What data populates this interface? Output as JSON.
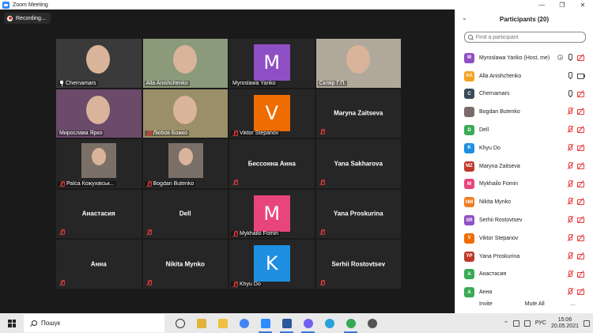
{
  "window": {
    "title": "Zoom Meeting",
    "minimize": "—",
    "maximize": "❐",
    "close": "✕"
  },
  "recording": {
    "label": "Recording..."
  },
  "tiles": [
    {
      "name": "Chernamars",
      "type": "video",
      "pin": true,
      "muted": false,
      "bg": "#3a3a3a"
    },
    {
      "name": "Alla Anishchenko",
      "type": "video",
      "active": true,
      "muted": false,
      "bg": "#8a9a7a"
    },
    {
      "name": "Myroslawa Yariko",
      "type": "letter",
      "letter": "M",
      "color": "#8f4fc4",
      "muted": false
    },
    {
      "name": "Скляр Г.П.",
      "type": "video",
      "muted": false,
      "bg": "#b0a89a"
    },
    {
      "name": "Мирослава Ярко",
      "type": "video",
      "muted": false,
      "bg": "#6b4a6a"
    },
    {
      "name": "Любов Божко",
      "type": "video",
      "muted": true,
      "bg": "#9b8f6a"
    },
    {
      "name": "Viktor Stepanov",
      "type": "letter",
      "letter": "V",
      "color": "#ef6c00",
      "muted": true
    },
    {
      "name": "Maryna Zaitseva",
      "type": "name",
      "muted": true
    },
    {
      "name": "Раїса Кожухівськ...",
      "type": "video",
      "muted": true,
      "bg": "#262626"
    },
    {
      "name": "Bogdan Butenko",
      "type": "video",
      "muted": true,
      "bg": "#262626"
    },
    {
      "name": "Бессонна Анна",
      "type": "name",
      "muted": true
    },
    {
      "name": "Yana Sakharova",
      "type": "name",
      "muted": true
    },
    {
      "name": "Анастасия",
      "type": "name",
      "muted": true
    },
    {
      "name": "Dell",
      "type": "name",
      "muted": true
    },
    {
      "name": "Mykhailo Fomin",
      "type": "letter",
      "letter": "M",
      "color": "#e8457c",
      "muted": true
    },
    {
      "name": "Yana Proskurina",
      "type": "name",
      "muted": true
    },
    {
      "name": "Анна",
      "type": "name",
      "muted": true
    },
    {
      "name": "Nikita Mynko",
      "type": "name",
      "muted": true
    },
    {
      "name": "Khyu Do",
      "type": "letter",
      "letter": "K",
      "color": "#1e8fe1",
      "muted": true
    },
    {
      "name": "Serhii Rostovtsev",
      "type": "name",
      "muted": true
    }
  ],
  "panel": {
    "title": "Participants (20)",
    "collapse_icon": "⌄",
    "search_placeholder": "Find a participant",
    "participants": [
      {
        "initials": "M",
        "name": "Myroslawa Yariko (Host, me)",
        "color": "#8f4fc4",
        "state": "host"
      },
      {
        "initials": "AA",
        "name": "Alla Anishchenko",
        "color": "#f4a11d",
        "state": "live"
      },
      {
        "initials": "C",
        "name": "Chernamars",
        "color": "#3b4a5a",
        "state": "mic-on-cam-muted"
      },
      {
        "initials": "",
        "name": "Bogdan Butenko",
        "color": "#7a6a6a",
        "state": "muted"
      },
      {
        "initials": "D",
        "name": "Dell",
        "color": "#3aaa55",
        "state": "muted"
      },
      {
        "initials": "K",
        "name": "Khyu Do",
        "color": "#1e8fe1",
        "state": "muted"
      },
      {
        "initials": "MZ",
        "name": "Maryna Zaitseva",
        "color": "#c0392b",
        "state": "muted"
      },
      {
        "initials": "M",
        "name": "Mykhailo Fomin",
        "color": "#e8457c",
        "state": "muted"
      },
      {
        "initials": "NM",
        "name": "Nikita Mynko",
        "color": "#f07d23",
        "state": "muted"
      },
      {
        "initials": "SR",
        "name": "Serhii Rostovtsev",
        "color": "#8f4fc4",
        "state": "muted"
      },
      {
        "initials": "V",
        "name": "Viktor Stepanov",
        "color": "#ef6c00",
        "state": "muted"
      },
      {
        "initials": "YP",
        "name": "Yana Proskurina",
        "color": "#c0392b",
        "state": "muted"
      },
      {
        "initials": "A",
        "name": "Анастасия",
        "color": "#3aaa55",
        "state": "muted"
      },
      {
        "initials": "A",
        "name": "Анна",
        "color": "#3aaa55",
        "state": "muted"
      }
    ],
    "invite_label": "Invite",
    "mute_all_label": "Mute All",
    "more_label": "..."
  },
  "taskbar": {
    "search_text": "Пошук",
    "apps": [
      {
        "name": "task-view",
        "color": "#333333"
      },
      {
        "name": "explorer",
        "color": "#e2b33a"
      },
      {
        "name": "file-explorer",
        "color": "#f0c040"
      },
      {
        "name": "chrome",
        "color": "#4285f4"
      },
      {
        "name": "zoom",
        "color": "#2D8CFF",
        "active": true
      },
      {
        "name": "word",
        "color": "#2b579a",
        "active": true
      },
      {
        "name": "viber",
        "color": "#7360f2",
        "active": true
      },
      {
        "name": "telegram",
        "color": "#2aa1da"
      },
      {
        "name": "chrome-2",
        "color": "#34a853",
        "active": true
      },
      {
        "name": "settings",
        "color": "#555555"
      }
    ],
    "language": "РУС",
    "time": "15:06",
    "date": "20.05.2021"
  }
}
